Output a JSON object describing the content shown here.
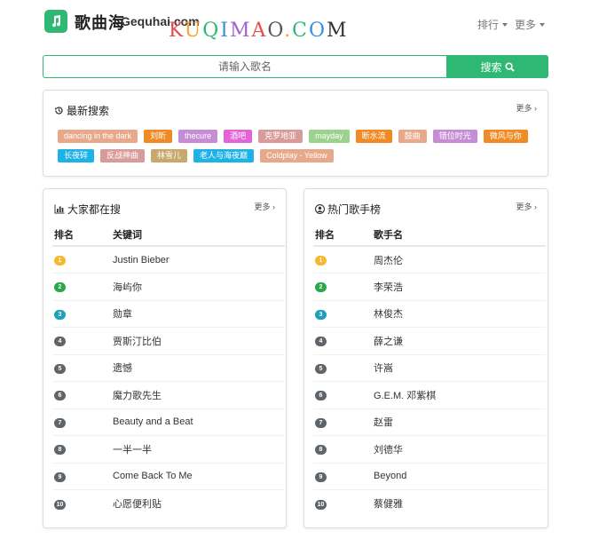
{
  "brand": {
    "name": "歌曲海",
    "domain": "Gequhai.com",
    "watermark": "KUQIMAO.COM"
  },
  "nav": {
    "rank_label": "排行",
    "more_label": "更多"
  },
  "search": {
    "placeholder": "请输入歌名",
    "button_label": "搜索"
  },
  "recent": {
    "title": "最新搜索",
    "more": "更多",
    "tags": [
      {
        "label": "dancing in the dark",
        "color": "#e8a98a"
      },
      {
        "label": "刘昕",
        "color": "#f08a24"
      },
      {
        "label": "thecure",
        "color": "#c68dd6"
      },
      {
        "label": "酒吧",
        "color": "#e264d6"
      },
      {
        "label": "克罗地亚",
        "color": "#d99a9a"
      },
      {
        "label": "mayday",
        "color": "#9bd38e"
      },
      {
        "label": "断水流",
        "color": "#f08a24"
      },
      {
        "label": "鼓曲",
        "color": "#e8a98a"
      },
      {
        "label": "错位时光",
        "color": "#c68dd6"
      },
      {
        "label": "微风与你",
        "color": "#f08a24"
      },
      {
        "label": "长夜碎",
        "color": "#1fb2e6"
      },
      {
        "label": "反战神曲",
        "color": "#d99a9a"
      },
      {
        "label": "林雪儿",
        "color": "#c7a86d"
      },
      {
        "label": "老人与海夜巅",
        "color": "#1fb2e6"
      },
      {
        "label": "Coldplay - Yellow",
        "color": "#e8a98a"
      }
    ]
  },
  "popular": {
    "title": "大家都在搜",
    "more": "更多",
    "col_rank": "排名",
    "col_keyword": "关键词",
    "rows": [
      {
        "rank": "1",
        "text": "Justin Bieber"
      },
      {
        "rank": "2",
        "text": "海屿你"
      },
      {
        "rank": "3",
        "text": "勋章"
      },
      {
        "rank": "4",
        "text": "贾斯汀比伯"
      },
      {
        "rank": "5",
        "text": "遗憾"
      },
      {
        "rank": "6",
        "text": "魔力歌先生"
      },
      {
        "rank": "7",
        "text": "Beauty and a Beat"
      },
      {
        "rank": "8",
        "text": "一半一半"
      },
      {
        "rank": "9",
        "text": "Come Back To Me"
      },
      {
        "rank": "10",
        "text": "心愿便利贴"
      }
    ]
  },
  "singers": {
    "title": "热门歌手榜",
    "more": "更多",
    "col_rank": "排名",
    "col_name": "歌手名",
    "rows": [
      {
        "rank": "1",
        "text": "周杰伦"
      },
      {
        "rank": "2",
        "text": "李荣浩"
      },
      {
        "rank": "3",
        "text": "林俊杰"
      },
      {
        "rank": "4",
        "text": "薛之谦"
      },
      {
        "rank": "5",
        "text": "许嵩"
      },
      {
        "rank": "6",
        "text": "G.E.M. 邓紫棋"
      },
      {
        "rank": "7",
        "text": "赵雷"
      },
      {
        "rank": "8",
        "text": "刘德华"
      },
      {
        "rank": "9",
        "text": "Beyond"
      },
      {
        "rank": "10",
        "text": "蔡健雅"
      }
    ]
  },
  "badge_colors": {
    "1": "#f5b82e",
    "2": "#2aa84a",
    "3": "#1ea0b8",
    "default": "#5f6469"
  }
}
